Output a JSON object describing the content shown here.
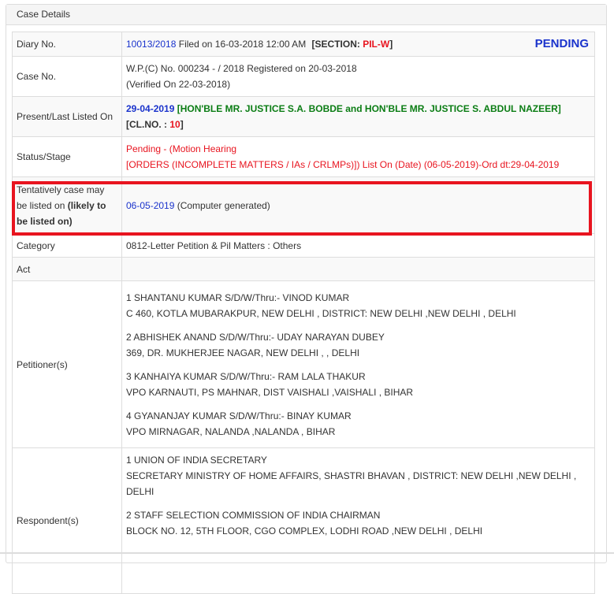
{
  "panel": {
    "title": "Case Details"
  },
  "rows": {
    "diary": {
      "label": "Diary No.",
      "number": "10013/2018",
      "filed": " Filed on 16-03-2018 12:00 AM ",
      "section_prefix": "[SECTION: ",
      "section_value": "PIL-W",
      "section_suffix": "]",
      "status_badge": "PENDING"
    },
    "case_no": {
      "label": "Case No.",
      "line1": "W.P.(C) No. 000234 - / 2018  Registered on 20-03-2018",
      "line2": "(Verified On 22-03-2018)"
    },
    "listed": {
      "label": "Present/Last Listed On",
      "date": "29-04-2019",
      "bench": " [HON'BLE MR. JUSTICE S.A. BOBDE and HON'BLE MR. JUSTICE S. ABDUL NAZEER]",
      "clno_prefix": "[CL.NO. : ",
      "clno_value": "10",
      "clno_suffix": "]"
    },
    "status": {
      "label": "Status/Stage",
      "line1": "Pending - (Motion Hearing",
      "line2": "[ORDERS (INCOMPLETE MATTERS / IAs / CRLMPs)]) List On (Date) (06-05-2019)-Ord dt:29-04-2019"
    },
    "tentative": {
      "label_prefix": "Tentatively case may be listed on ",
      "label_bold": "(likely to be listed on)",
      "date": "06-05-2019",
      "note": " (Computer generated)"
    },
    "category": {
      "label": "Category",
      "value": "0812-Letter Petition & Pil Matters : Others"
    },
    "act": {
      "label": "Act",
      "value": ""
    },
    "petitioners": {
      "label": "Petitioner(s)",
      "items": [
        {
          "name": "1 SHANTANU KUMAR S/D/W/Thru:- VINOD KUMAR",
          "address": "C 460, KOTLA MUBARAKPUR, NEW DELHI , DISTRICT: NEW DELHI ,NEW DELHI , DELHI"
        },
        {
          "name": "2 ABHISHEK ANAND S/D/W/Thru:- UDAY NARAYAN DUBEY",
          "address": "369, DR. MUKHERJEE NAGAR, NEW DELHI , , DELHI"
        },
        {
          "name": "3 KANHAIYA KUMAR S/D/W/Thru:- RAM LALA THAKUR",
          "address": "VPO KARNAUTI, PS MAHNAR, DIST VAISHALI ,VAISHALI , BIHAR"
        },
        {
          "name": "4 GYANANJAY KUMAR S/D/W/Thru:- BINAY KUMAR",
          "address": "VPO MIRNAGAR, NALANDA ,NALANDA , BIHAR"
        }
      ]
    },
    "respondents": {
      "label": "Respondent(s)",
      "items": [
        {
          "name": "1 UNION OF INDIA SECRETARY",
          "address": "SECRETARY MINISTRY OF HOME AFFAIRS, SHASTRI BHAVAN , DISTRICT: NEW DELHI ,NEW DELHI , DELHI"
        },
        {
          "name": "2 STAFF SELECTION COMMISSION OF INDIA CHAIRMAN",
          "address": "BLOCK NO. 12, 5TH FLOOR, CGO COMPLEX, LODHI ROAD ,NEW DELHI , DELHI"
        }
      ]
    }
  },
  "colors": {
    "highlight": "#e8141f",
    "link_blue": "#1a33cc",
    "section_red": "#e8141f",
    "bench_green": "#0b7d14"
  }
}
